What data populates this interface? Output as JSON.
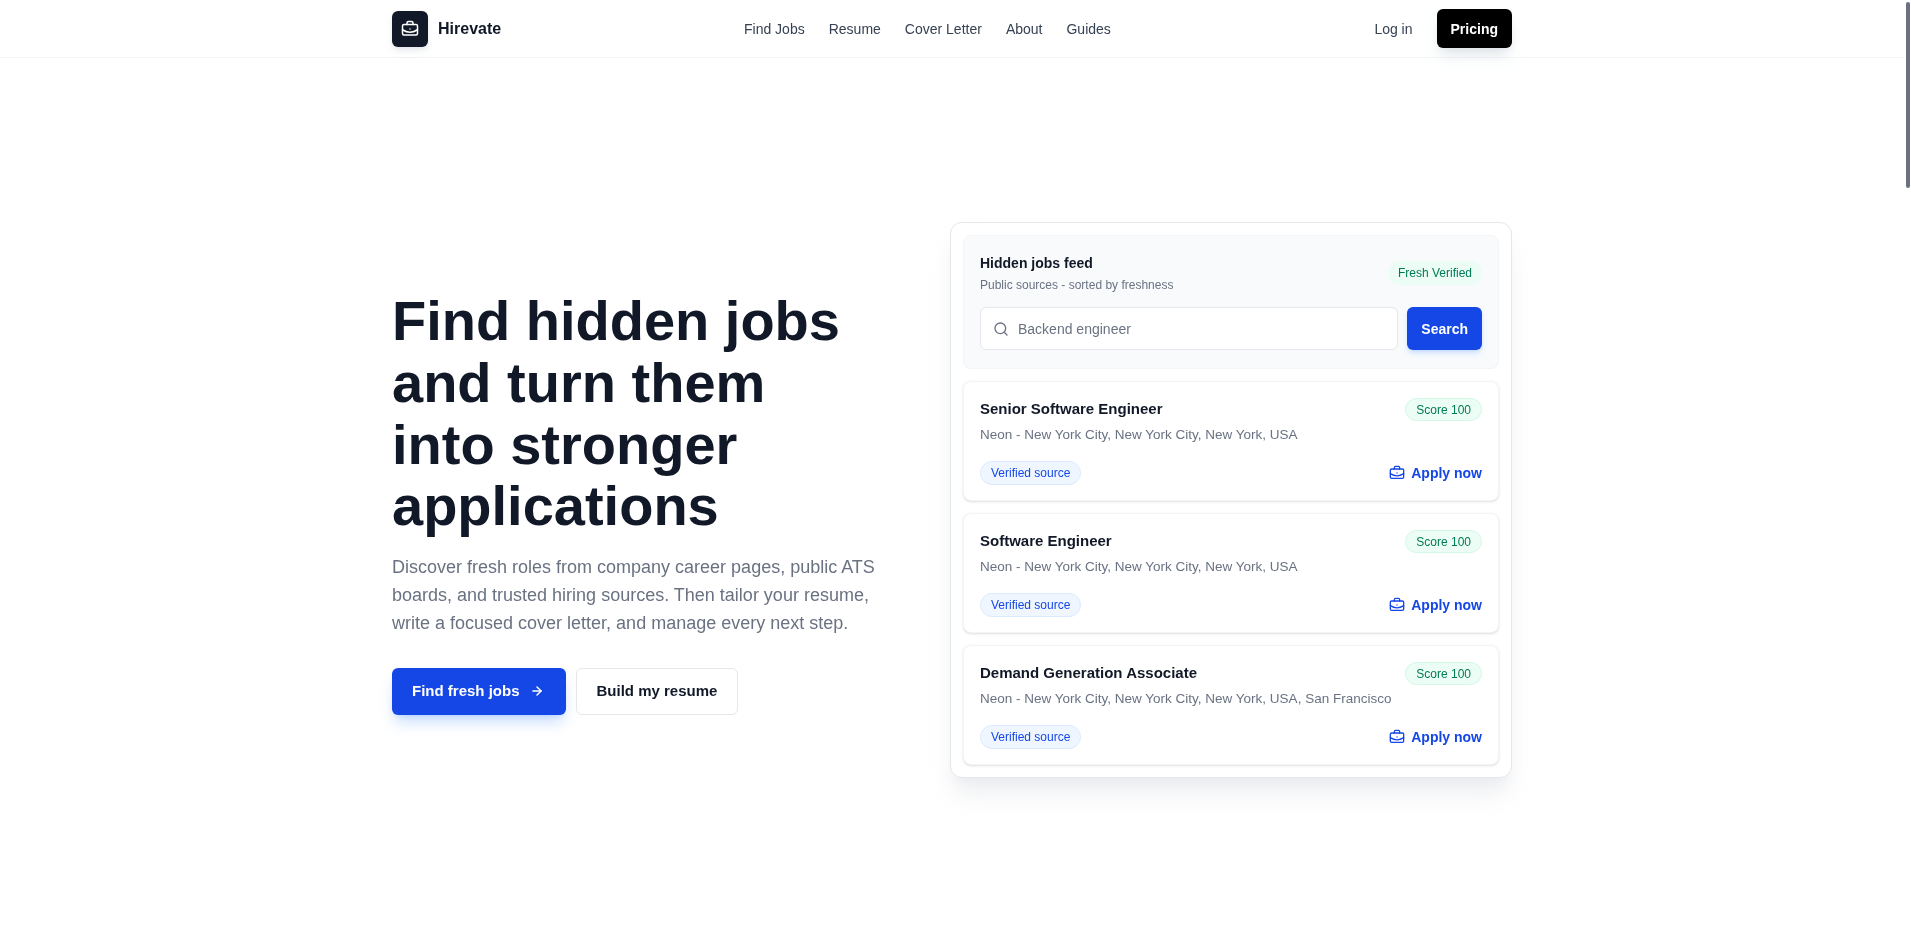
{
  "header": {
    "brand": "Hirevate",
    "nav": [
      {
        "label": "Find Jobs"
      },
      {
        "label": "Resume"
      },
      {
        "label": "Cover Letter"
      },
      {
        "label": "About"
      },
      {
        "label": "Guides"
      }
    ],
    "login": "Log in",
    "pricing": "Pricing"
  },
  "hero": {
    "title": "Find hidden jobs and turn them into stronger applications",
    "description": "Discover fresh roles from company career pages, public ATS boards, and trusted hiring sources. Then tailor your resume, write a focused cover letter, and manage every next step.",
    "buttons": [
      {
        "label": "Find fresh jobs",
        "kind": "primary"
      },
      {
        "label": "Build my resume",
        "kind": "secondary"
      }
    ]
  },
  "feed": {
    "title": "Hidden jobs feed",
    "subtitle": "Public sources - sorted by freshness",
    "badge": "Fresh Verified",
    "search": {
      "placeholder": "Backend engineer",
      "button": "Search"
    },
    "jobs": [
      {
        "title": "Senior Software Engineer",
        "location": "Neon - New York City, New York City, New York, USA",
        "score": "Score 100",
        "source": "Verified source",
        "action": "Apply now"
      },
      {
        "title": "Software Engineer",
        "location": "Neon - New York City, New York City, New York, USA",
        "score": "Score 100",
        "source": "Verified source",
        "action": "Apply now"
      },
      {
        "title": "Demand Generation Associate",
        "location": "Neon - New York City, New York City, New York, USA, San Francisco",
        "score": "Score 100",
        "source": "Verified source",
        "action": "Apply now"
      }
    ]
  }
}
